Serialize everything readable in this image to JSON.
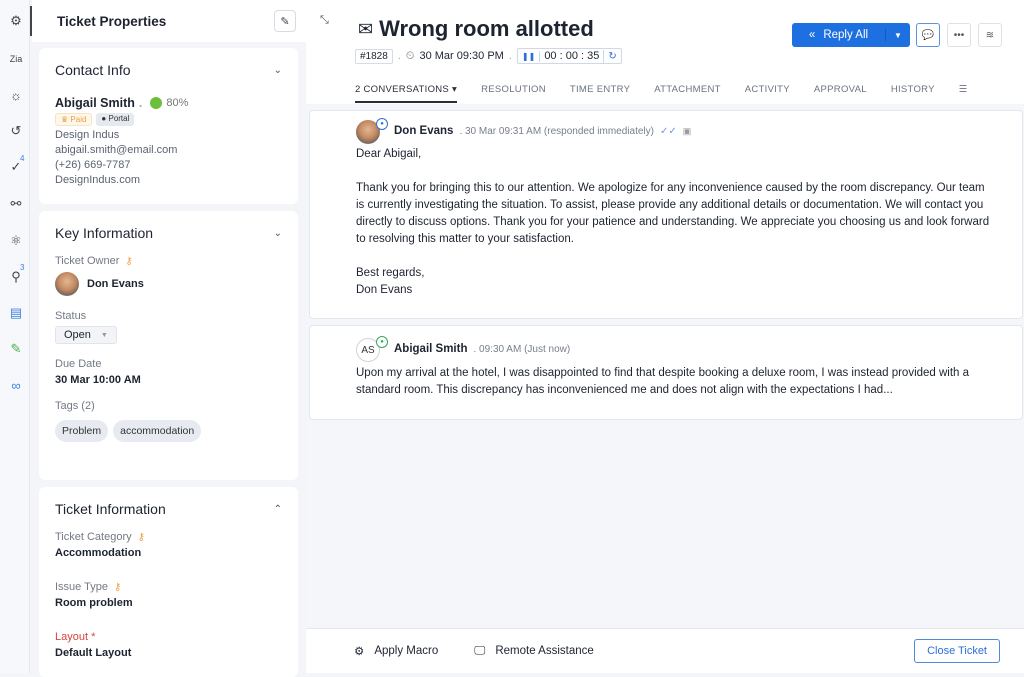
{
  "rail": {
    "items": [
      {
        "icon": "ticket-settings-icon"
      },
      {
        "icon": "zia-icon"
      },
      {
        "icon": "bulb-icon"
      },
      {
        "icon": "history-icon"
      },
      {
        "icon": "check-circle-icon",
        "badge": "4"
      },
      {
        "icon": "share-icon"
      },
      {
        "icon": "atom-icon"
      },
      {
        "icon": "magic-wand-icon",
        "badge": "3"
      },
      {
        "icon": "layout-icon"
      },
      {
        "icon": "sign-icon"
      },
      {
        "icon": "link-icon"
      }
    ]
  },
  "properties": {
    "title": "Ticket Properties",
    "contact": {
      "section_title": "Contact Info",
      "name": "Abigail Smith",
      "happiness": "80%",
      "badge_paid": "Paid",
      "badge_portal": "Portal",
      "company": "Design Indus",
      "email": "abigail.smith@email.com",
      "phone": "(+26) 669-7787",
      "website": "DesignIndus.com"
    },
    "key_info": {
      "section_title": "Key Information",
      "owner_label": "Ticket Owner",
      "owner": "Don Evans",
      "status_label": "Status",
      "status": "Open",
      "due_label": "Due Date",
      "due": "30 Mar 10:00 AM",
      "tags_label": "Tags (2)",
      "tags": [
        "Problem",
        "accommodation"
      ]
    },
    "ticket_info": {
      "section_title": "Ticket Information",
      "category_label": "Ticket Category",
      "category": "Accommodation",
      "issue_label": "Issue Type",
      "issue": "Room problem",
      "layout_label": "Layout *",
      "layout": "Default Layout"
    }
  },
  "ticket": {
    "subject": "Wrong room allotted",
    "id": "#1828",
    "created": "30 Mar 09:30 PM",
    "timer": "00 : 00 : 35",
    "reply_all": "Reply All",
    "tabs": [
      "2 CONVERSATIONS",
      "RESOLUTION",
      "TIME ENTRY",
      "ATTACHMENT",
      "ACTIVITY",
      "APPROVAL",
      "HISTORY"
    ]
  },
  "conversations": [
    {
      "author": "Don Evans",
      "time": ". 30 Mar 09:31 AM (responded immediately)",
      "greeting": "Dear Abigail,",
      "body": "Thank you for bringing this to our attention. We apologize for any inconvenience caused by the room discrepancy. Our team is currently investigating the situation. To assist, please provide any additional details or documentation. We will contact you directly to discuss options. Thank you for your patience and understanding. We appreciate you choosing us and look forward to resolving this matter to your satisfaction.",
      "signoff": "Best regards,",
      "signature": "Don Evans"
    },
    {
      "author": "Abigail Smith",
      "initials": "AS",
      "time": ". 09:30 AM (Just now)",
      "body": "Upon my arrival at the hotel, I was disappointed to find that despite booking a deluxe room, I was instead provided with a standard room. This discrepancy has inconvenienced me and does not align with the expectations I had..."
    }
  ],
  "footer": {
    "apply_macro": "Apply Macro",
    "remote_assistance": "Remote Assistance",
    "close_ticket": "Close Ticket"
  }
}
